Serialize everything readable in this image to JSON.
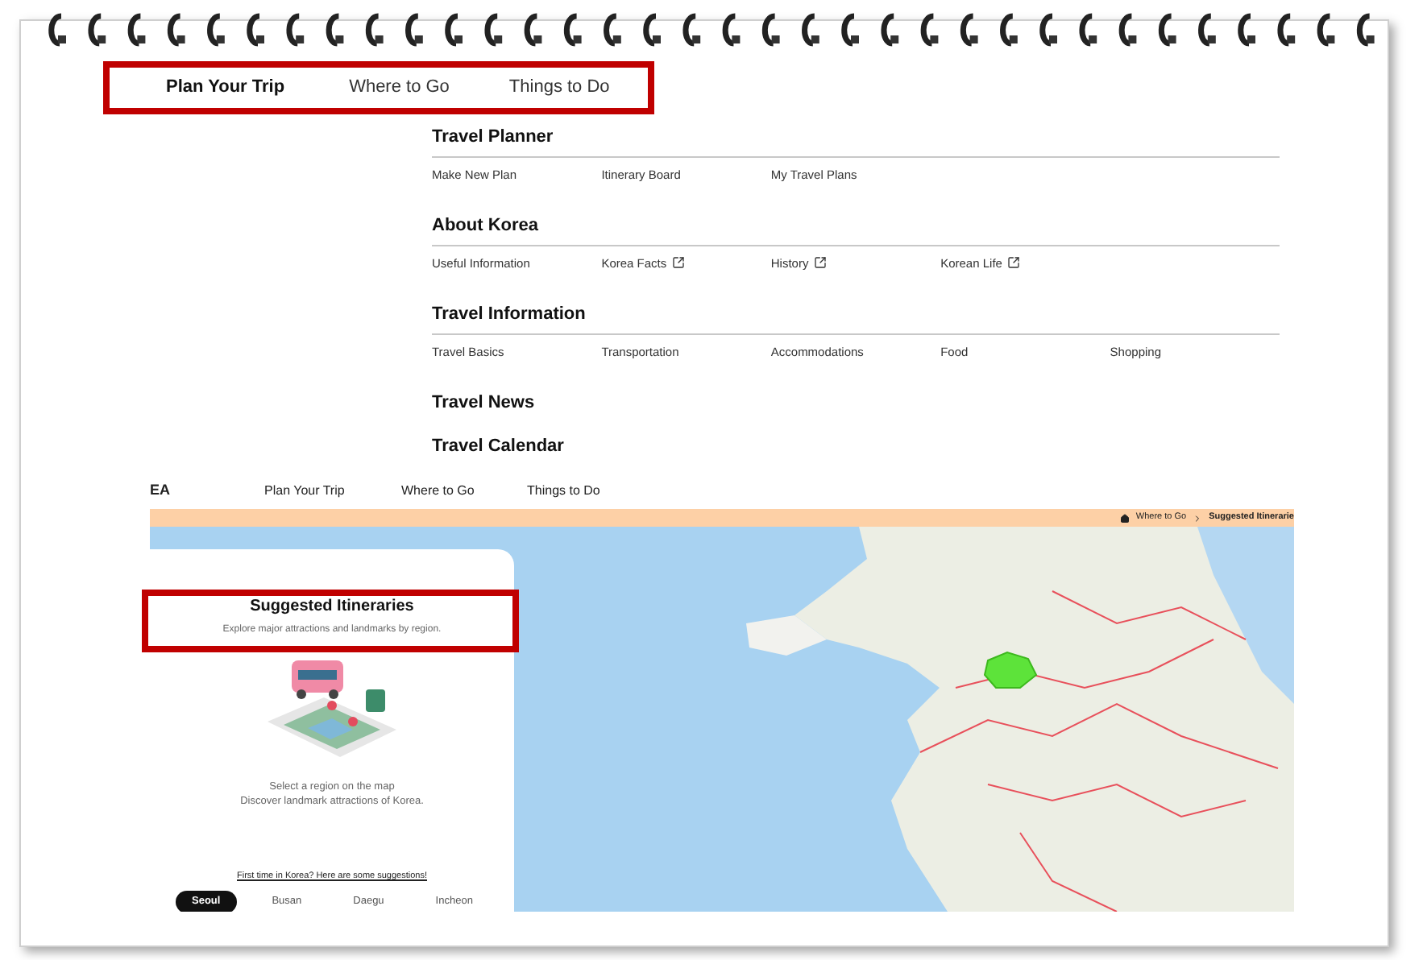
{
  "top_nav": [
    {
      "label": "Plan Your Trip",
      "selected": true
    },
    {
      "label": "Where to Go",
      "selected": false
    },
    {
      "label": "Things to Do",
      "selected": false
    }
  ],
  "menu_sections": [
    {
      "title": "Travel Planner",
      "links": [
        {
          "label": "Make New Plan",
          "external": false
        },
        {
          "label": "Itinerary Board",
          "external": false
        },
        {
          "label": "My Travel Plans",
          "external": false
        }
      ]
    },
    {
      "title": "About Korea",
      "links": [
        {
          "label": "Useful Information",
          "external": false
        },
        {
          "label": "Korea Facts",
          "external": true
        },
        {
          "label": "History",
          "external": true
        },
        {
          "label": "Korean Life",
          "external": true
        }
      ]
    },
    {
      "title": "Travel Information",
      "links": [
        {
          "label": "Travel Basics",
          "external": false
        },
        {
          "label": "Transportation",
          "external": false
        },
        {
          "label": "Accommodations",
          "external": false
        },
        {
          "label": "Food",
          "external": false
        },
        {
          "label": "Shopping",
          "external": false
        }
      ]
    },
    {
      "title": "Travel News"
    },
    {
      "title": "Travel Calendar"
    }
  ],
  "embedded_page": {
    "logo": "EA",
    "nav": [
      "Plan Your Trip",
      "Where to Go",
      "Things to Do"
    ],
    "breadcrumb": [
      "Where to Go",
      "Suggested Itinerarie"
    ],
    "panel": {
      "title": "Suggested Itineraries",
      "subtitle": "Explore major attractions and landmarks by region.",
      "hint_lines": [
        "Select a region on the map",
        "Discover landmark attractions of Korea."
      ],
      "link": "First time in Korea? Here are some suggestions!",
      "regions": [
        {
          "label": "Seoul",
          "selected": true
        },
        {
          "label": "Busan",
          "selected": false
        },
        {
          "label": "Daegu",
          "selected": false
        },
        {
          "label": "Incheon",
          "selected": false
        }
      ]
    }
  }
}
